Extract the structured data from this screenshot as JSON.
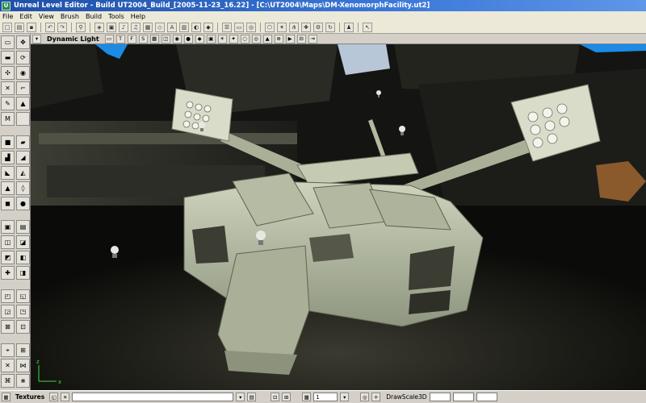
{
  "window": {
    "title": "Unreal Level Editor - Build UT2004_Build_[2005-11-23_16.22] - [C:\\UT2004\\Maps\\DM-XenomorphFacility.ut2]",
    "icon": "unreal-editor-icon"
  },
  "menu": [
    "File",
    "Edit",
    "View",
    "Brush",
    "Build",
    "Tools",
    "Help"
  ],
  "viewport": {
    "title": "Dynamic Light",
    "axis": {
      "x": "x",
      "z": "z"
    }
  },
  "statusbar": {
    "browser_label": "Textures",
    "grid_value": "1",
    "drawscale_label": "DrawScale3D"
  },
  "colors": {
    "titlebar": "#2a5bbf",
    "sky": "#1b8be6",
    "hull": "#b9c0a6"
  }
}
